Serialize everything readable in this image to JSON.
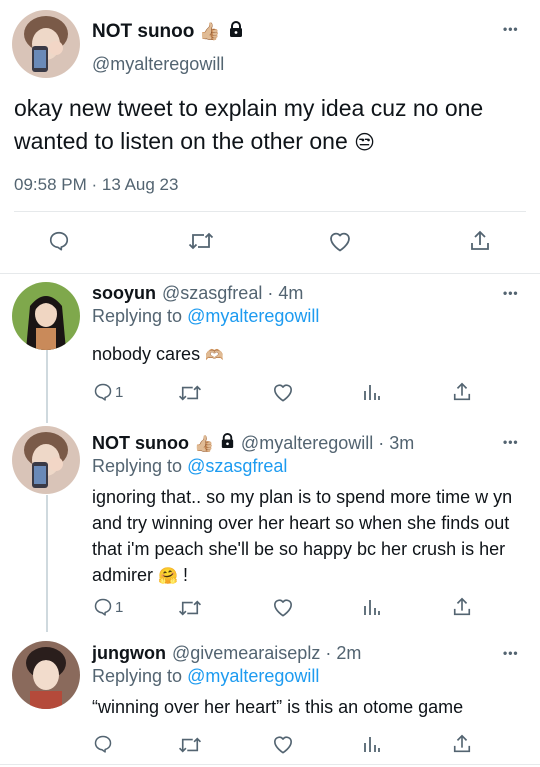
{
  "main_tweet": {
    "display_name": "NOT sunoo",
    "name_emoji": "👍🏼",
    "handle": "@myalteregowill",
    "text": "okay new tweet to explain my idea cuz no one wanted to listen on the other one",
    "text_emoji": "😒",
    "timestamp": "09:58 PM · 13 Aug 23",
    "more": "•••"
  },
  "replies": [
    {
      "display_name": "sooyun",
      "handle": "@szasgfreal",
      "time": "· 4m",
      "replying_prefix": "Replying to",
      "replying_to": "@myalteregowill",
      "text": "nobody cares",
      "text_emoji": "🫶🏼",
      "reply_count": "1",
      "more": "•••"
    },
    {
      "display_name": "NOT sunoo",
      "name_emoji": "👍🏼",
      "handle": "@myalteregowill",
      "time": "· 3m",
      "replying_prefix": "Replying to",
      "replying_to": "@szasgfreal",
      "text": "ignoring that.. so my plan is to spend more time w yn and try winning over her heart so when she finds out that i'm peach she'll be so happy bc her crush is her admirer",
      "text_emoji": "🤗",
      "text_suffix": " !",
      "reply_count": "1",
      "more": "•••"
    },
    {
      "display_name": "jungwon",
      "handle": "@givemearaiseplz",
      "time": "· 2m",
      "replying_prefix": "Replying to",
      "replying_to": "@myalteregowill",
      "text": "“winning over her heart” is this an otome game",
      "more": "•••"
    }
  ],
  "icons": [
    "reply-icon",
    "retweet-icon",
    "like-icon",
    "share-icon",
    "analytics-icon",
    "lock-icon"
  ],
  "colors": {
    "text": "#0f1419",
    "secondary": "#536471",
    "link": "#1d9bf0",
    "divider": "#e6e9eb"
  }
}
